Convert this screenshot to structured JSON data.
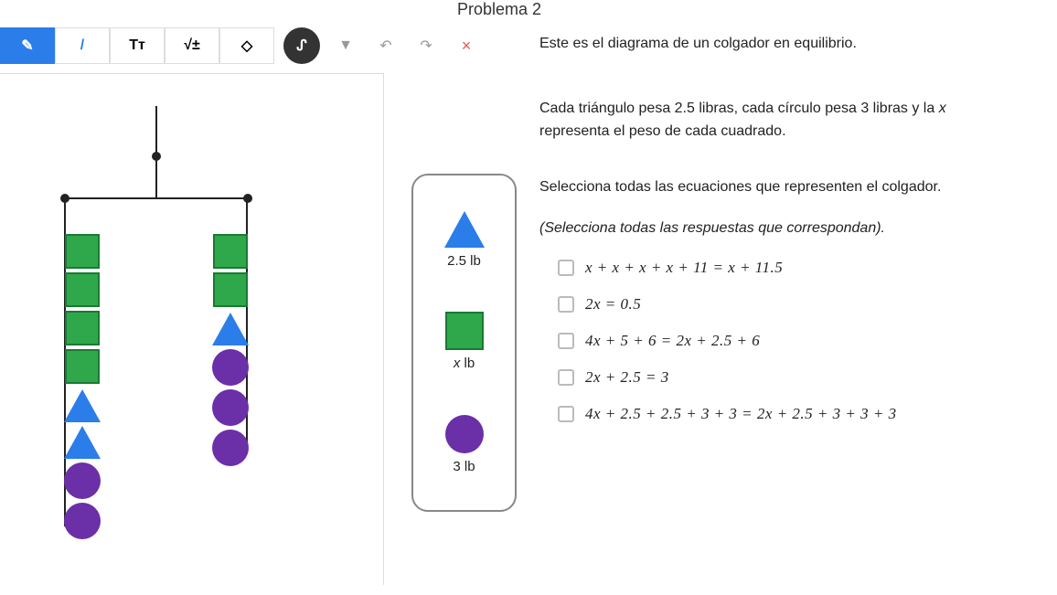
{
  "title": "Problema 2",
  "toolbar": {
    "pen": "✎",
    "line": "/",
    "text": "Tт",
    "math": "√±",
    "eraser": "◇",
    "freehand": "ᔑ",
    "undo": "↶",
    "redo": "↷",
    "close": "×"
  },
  "legend": {
    "triangle_label": "2.5 lb",
    "square_label": "x lb",
    "circle_label": "3 lb"
  },
  "content": {
    "p1": "Este es el diagrama de un colgador en equilibrio.",
    "p2_a": "Cada triángulo pesa ",
    "p2_v1": "2.5",
    "p2_b": " libras, cada círculo pesa ",
    "p2_v2": "3",
    "p2_c": " libras y la ",
    "p2_x": "x",
    "p2_d": " representa el peso de cada cuadrado.",
    "p3": "Selecciona todas las ecuaciones que representen el colgador.",
    "p4": "(Selecciona todas las respuestas que correspondan)."
  },
  "equations": [
    "x + x + x + x + 11 = x + 11.5",
    "2x = 0.5",
    "4x + 5 + 6 = 2x + 2.5 + 6",
    "2x + 2.5 = 3",
    "4x + 2.5 + 2.5 + 3 + 3 = 2x + 2.5 + 3 + 3 + 3"
  ],
  "chart_data": {
    "type": "diagram",
    "description": "Balance hanger diagram",
    "left_side": [
      "square",
      "square",
      "square",
      "square",
      "triangle",
      "triangle",
      "circle",
      "circle"
    ],
    "right_side": [
      "square",
      "square",
      "triangle",
      "circle",
      "circle",
      "circle"
    ],
    "weights": {
      "triangle": 2.5,
      "circle": 3,
      "square": "x"
    },
    "units": "lb"
  }
}
